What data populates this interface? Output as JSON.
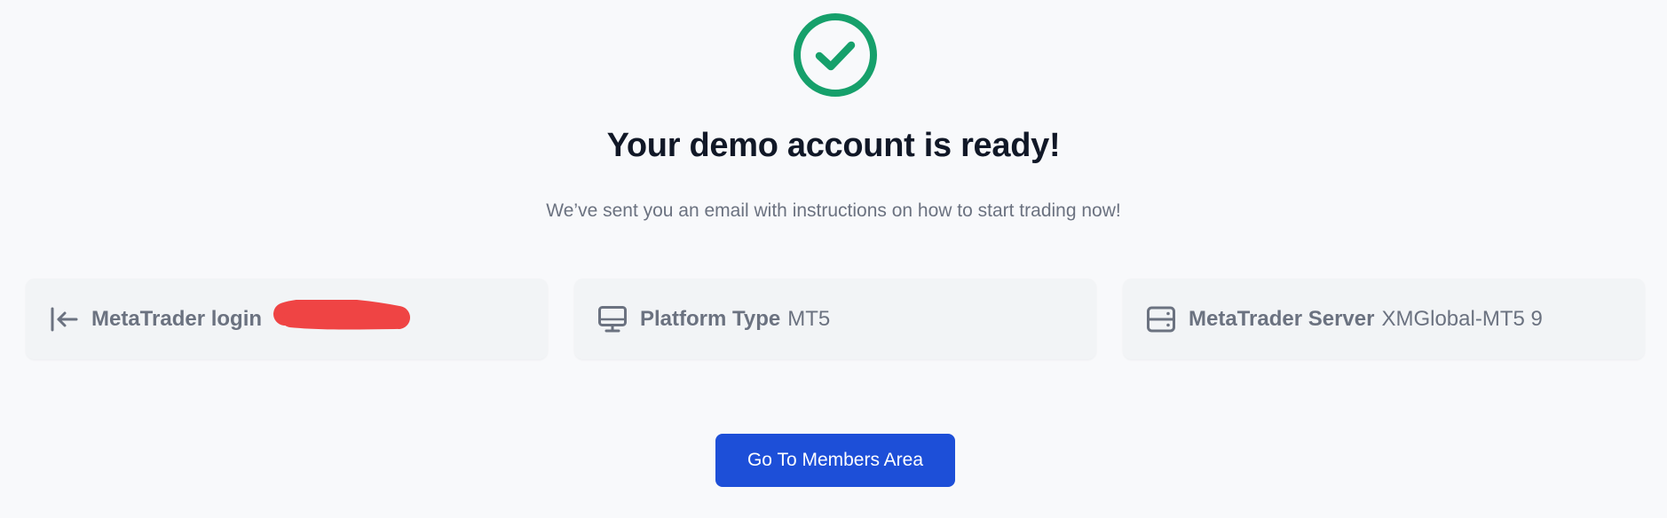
{
  "success_icon": {
    "name": "check-circle-icon",
    "color": "#16a06b"
  },
  "heading": "Your demo account is ready!",
  "subheading": "We’ve sent you an email with instructions on how to start trading now!",
  "cards": [
    {
      "icon": "login-arrow-icon",
      "label": "MetaTrader login",
      "value": "",
      "redacted": true
    },
    {
      "icon": "monitor-icon",
      "label": "Platform Type",
      "value": "MT5"
    },
    {
      "icon": "server-icon",
      "label": "MetaTrader Server",
      "value": "XMGlobal-MT5 9"
    }
  ],
  "cta_button": {
    "label": "Go To Members Area",
    "color": "#1d4fd8"
  },
  "colors": {
    "background": "#f8f9fb",
    "card_background": "#f2f4f6",
    "heading": "#111827",
    "muted_text": "#6b7280",
    "redaction": "#ef4444"
  }
}
